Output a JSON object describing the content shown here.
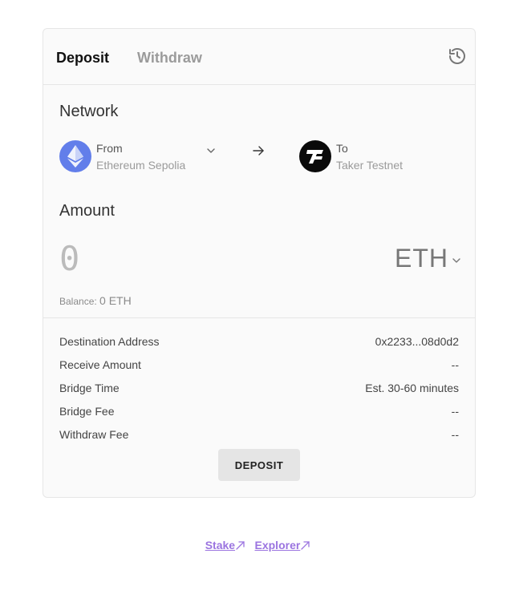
{
  "tabs": {
    "deposit": "Deposit",
    "withdraw": "Withdraw"
  },
  "network": {
    "title": "Network",
    "from": {
      "direction": "From",
      "chain": "Ethereum Sepolia",
      "icon": "ethereum-icon"
    },
    "to": {
      "direction": "To",
      "chain": "Taker Testnet",
      "icon": "taker-icon"
    }
  },
  "amount": {
    "title": "Amount",
    "placeholder": "0",
    "token": "ETH",
    "balance_label": "Balance:",
    "balance_value": "0 ETH"
  },
  "details": [
    {
      "label": "Destination Address",
      "value": "0x2233...08d0d2"
    },
    {
      "label": "Receive Amount",
      "value": "--"
    },
    {
      "label": "Bridge Time",
      "value": "Est. 30-60 minutes"
    },
    {
      "label": "Bridge Fee",
      "value": "--"
    },
    {
      "label": "Withdraw Fee",
      "value": "--"
    }
  ],
  "deposit_button": "DEPOSIT",
  "footer": {
    "stake": "Stake",
    "explorer": "Explorer"
  },
  "colors": {
    "accent": "#9b74e0",
    "ethereum": "#627eea",
    "taker": "#0a0a0a",
    "button": "#e5e5e5"
  }
}
